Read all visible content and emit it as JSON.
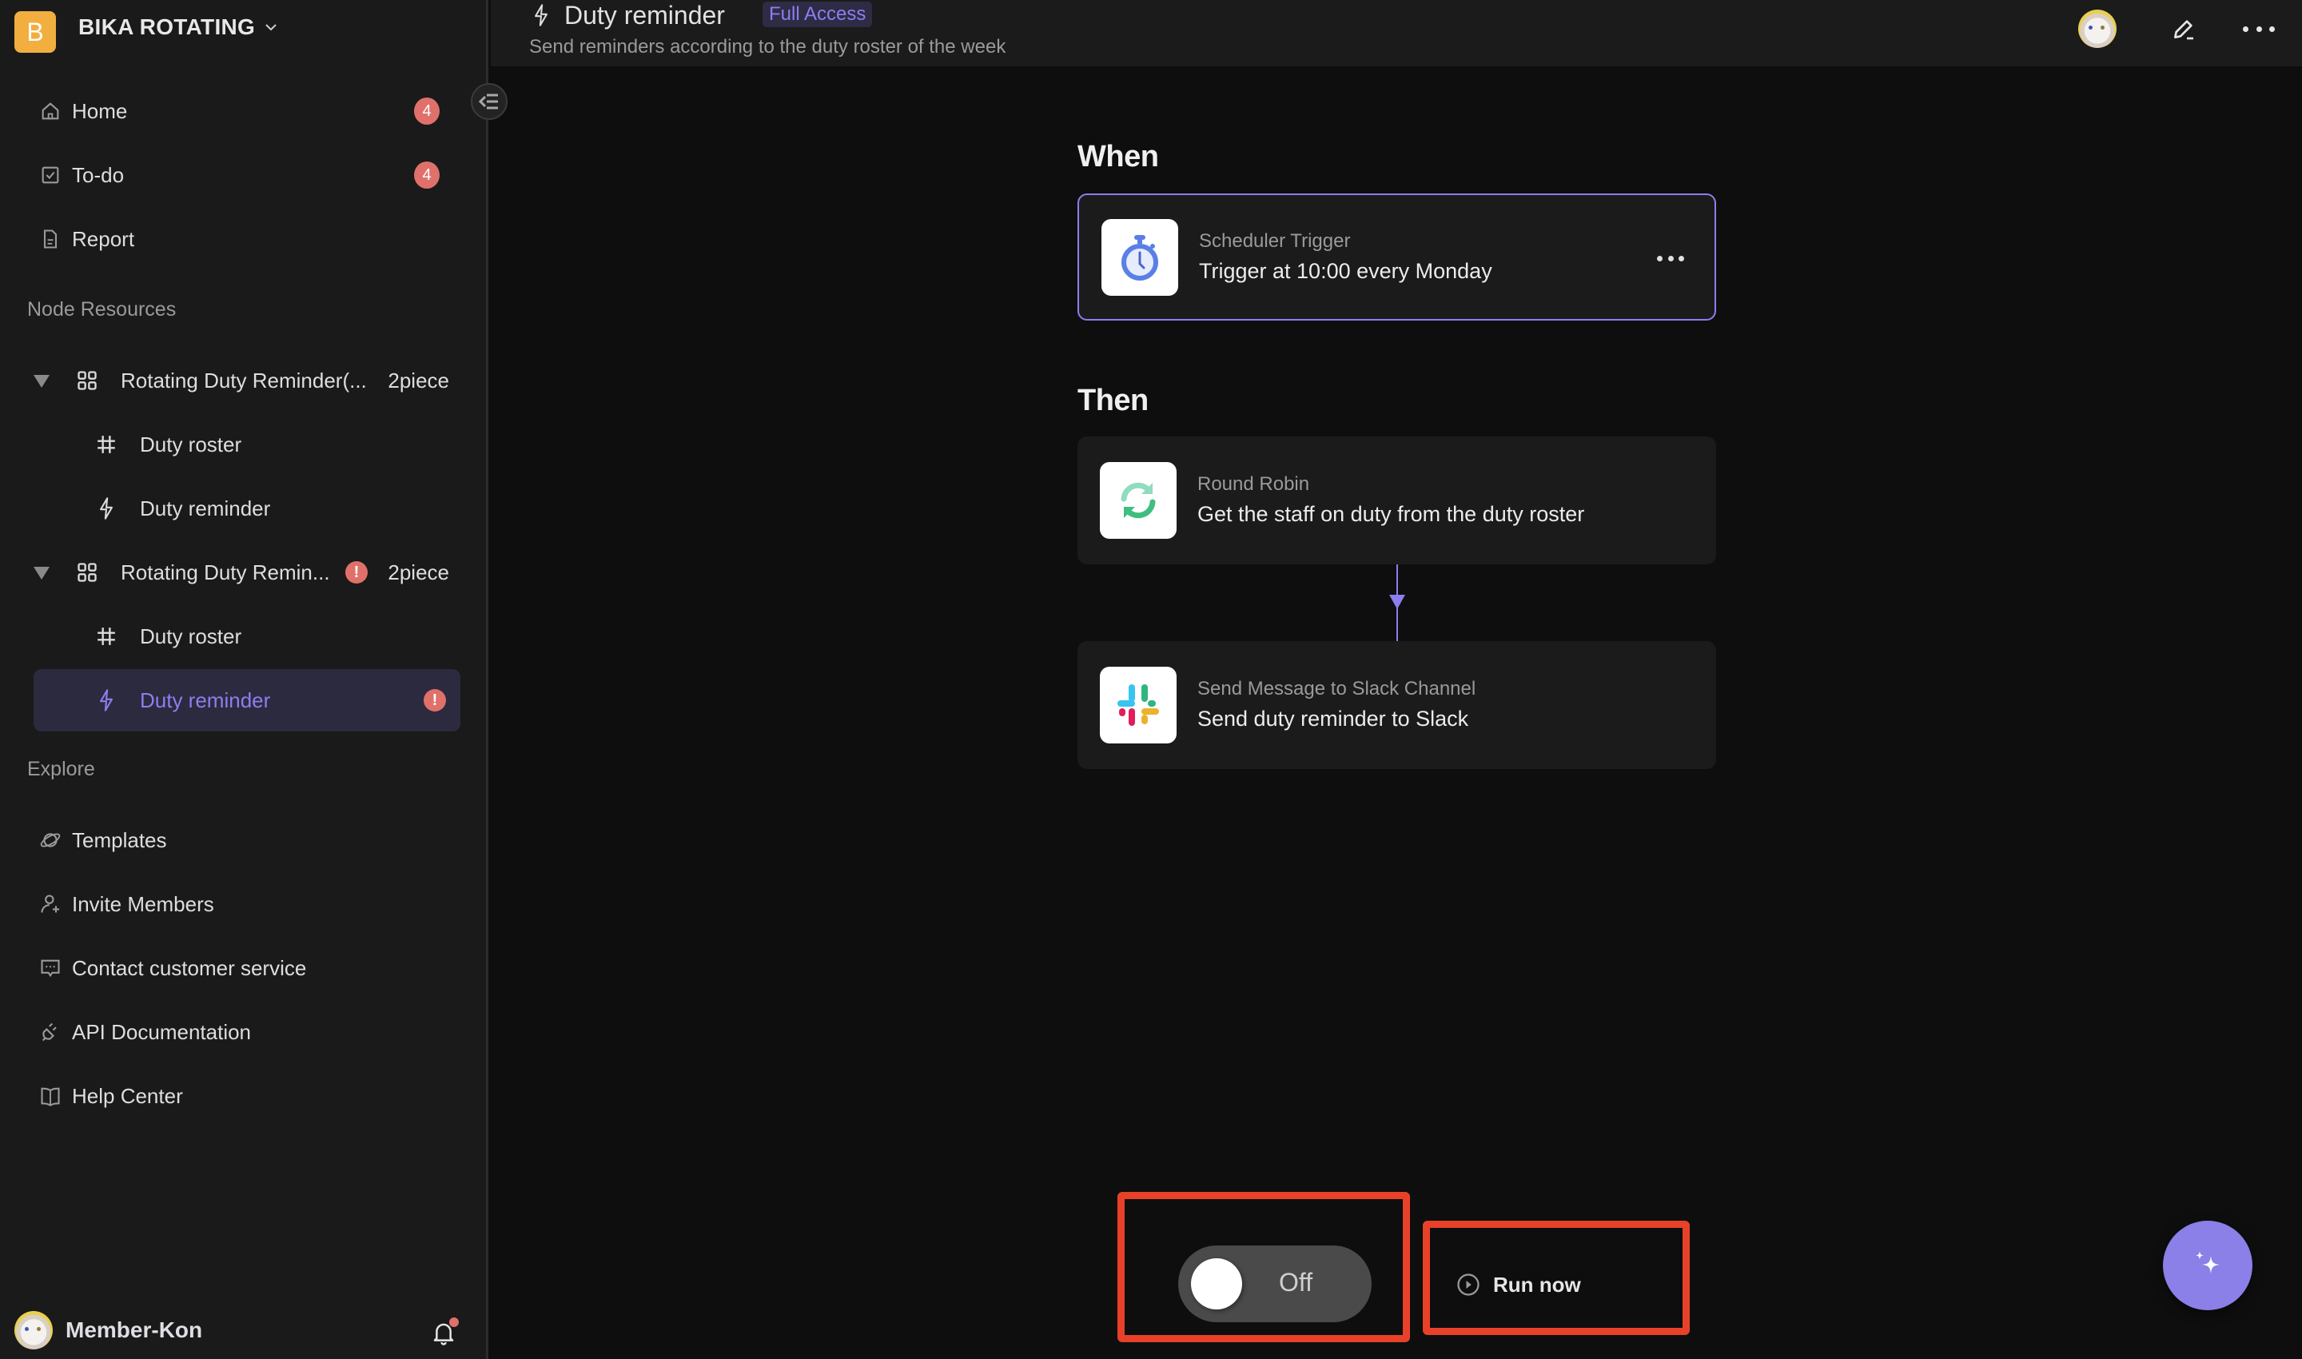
{
  "workspace": {
    "initial": "B",
    "name": "BIKA ROTATING",
    "logo_color": "#f2ae3f"
  },
  "nav": [
    {
      "label": "Home",
      "icon": "home-icon",
      "badge": "4"
    },
    {
      "label": "To-do",
      "icon": "checkbox-icon",
      "badge": "4"
    },
    {
      "label": "Report",
      "icon": "document-icon",
      "badge": null
    }
  ],
  "node_resources": {
    "label": "Node Resources",
    "folders": [
      {
        "name": "Rotating Duty Reminder(...",
        "count": "2piece",
        "has_error": false,
        "children": [
          {
            "label": "Duty roster",
            "icon": "grid-table-icon",
            "active": false,
            "has_error": false
          },
          {
            "label": "Duty reminder",
            "icon": "lightning-icon",
            "active": false,
            "has_error": false
          }
        ]
      },
      {
        "name": "Rotating Duty Remin...",
        "count": "2piece",
        "has_error": true,
        "children": [
          {
            "label": "Duty roster",
            "icon": "grid-table-icon",
            "active": false,
            "has_error": false
          },
          {
            "label": "Duty reminder",
            "icon": "lightning-icon",
            "active": true,
            "has_error": true
          }
        ]
      }
    ]
  },
  "explore": {
    "label": "Explore",
    "items": [
      {
        "label": "Templates",
        "icon": "planet-icon"
      },
      {
        "label": "Invite Members",
        "icon": "add-user-icon"
      },
      {
        "label": "Contact customer service",
        "icon": "chat-icon"
      },
      {
        "label": "API Documentation",
        "icon": "plug-icon"
      },
      {
        "label": "Help Center",
        "icon": "book-icon"
      }
    ]
  },
  "user": {
    "name": "Member-Kon",
    "has_notification": true
  },
  "header": {
    "title": "Duty reminder",
    "access_badge": "Full Access",
    "subtitle": "Send reminders according to the duty roster of the week"
  },
  "flow": {
    "when_label": "When",
    "then_label": "Then",
    "trigger": {
      "type": "Scheduler Trigger",
      "description": "Trigger at 10:00 every Monday",
      "icon": "stopwatch-icon"
    },
    "actions": [
      {
        "type": "Round Robin",
        "description": "Get the staff on duty from the duty roster",
        "icon": "refresh-cycle-icon"
      },
      {
        "type": "Send Message to Slack Channel",
        "description": "Send duty reminder to Slack",
        "icon": "slack-icon"
      }
    ]
  },
  "controls": {
    "toggle_state": "Off",
    "toggle_on": false,
    "run_now_label": "Run now"
  },
  "colors": {
    "accent": "#8b7ff0",
    "badge_red": "#e0716a",
    "highlight_red": "#e8412a"
  }
}
